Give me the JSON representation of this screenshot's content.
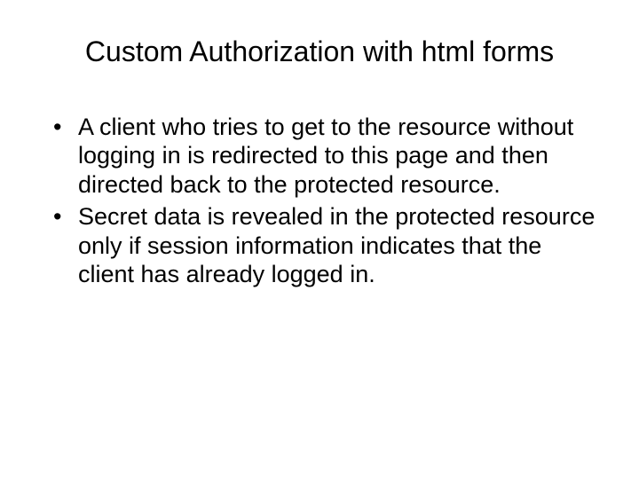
{
  "title": "Custom Authorization with html forms",
  "bullets": [
    "A client who tries to get to the resource without logging in is redirected to this page and then directed back to the protected resource.",
    "Secret data is revealed in the protected resource only if session information indicates that the client has already logged in."
  ]
}
